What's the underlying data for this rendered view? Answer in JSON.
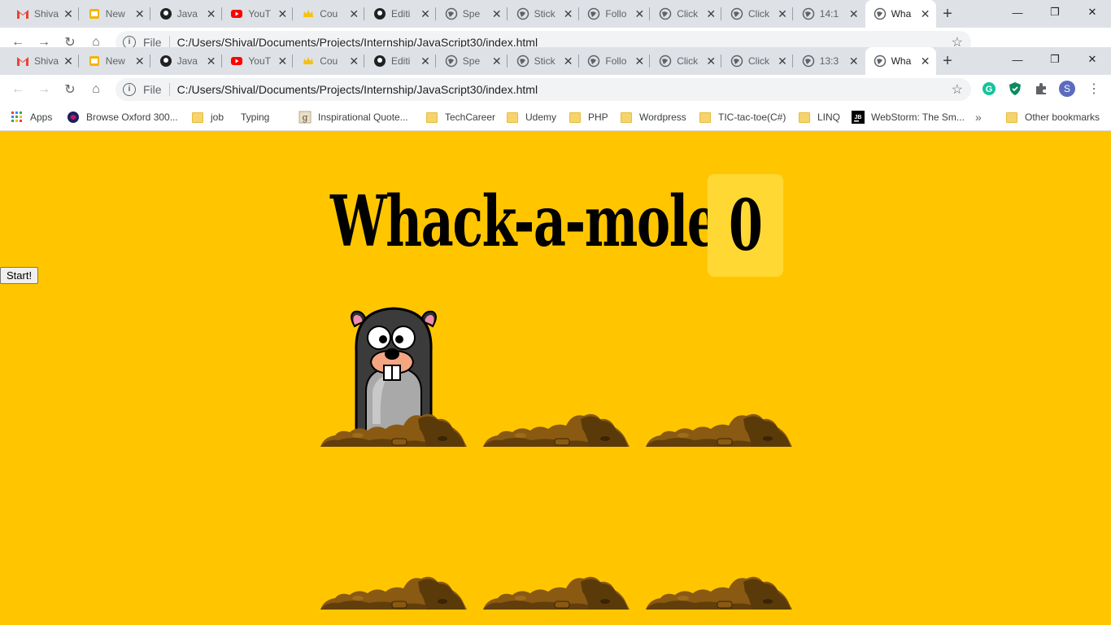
{
  "browser_back": {
    "tabs": [
      {
        "title": "Shiva",
        "icon": "gmail-icon"
      },
      {
        "title": "New",
        "icon": "slides-icon"
      },
      {
        "title": "Java",
        "icon": "github-icon"
      },
      {
        "title": "YouT",
        "icon": "youtube-icon"
      },
      {
        "title": "Cou",
        "icon": "crown-icon"
      },
      {
        "title": "Editi",
        "icon": "github-icon"
      },
      {
        "title": "Spe",
        "icon": "globe-icon"
      },
      {
        "title": "Stick",
        "icon": "globe-icon"
      },
      {
        "title": "Follo",
        "icon": "globe-icon"
      },
      {
        "title": "Click",
        "icon": "globe-icon"
      },
      {
        "title": "Click",
        "icon": "globe-icon"
      },
      {
        "title": "14:1",
        "icon": "globe-icon"
      },
      {
        "title": "Wha",
        "icon": "globe-icon"
      }
    ],
    "url": "C:/Users/Shival/Documents/Projects/Internship/JavaScript30/index.html",
    "file_label": "File"
  },
  "browser": {
    "tabs": [
      {
        "title": "Shiva",
        "icon": "gmail-icon"
      },
      {
        "title": "New",
        "icon": "slides-icon"
      },
      {
        "title": "Java",
        "icon": "github-icon"
      },
      {
        "title": "YouT",
        "icon": "youtube-icon"
      },
      {
        "title": "Cou",
        "icon": "crown-icon"
      },
      {
        "title": "Editi",
        "icon": "github-icon"
      },
      {
        "title": "Spe",
        "icon": "globe-icon"
      },
      {
        "title": "Stick",
        "icon": "globe-icon"
      },
      {
        "title": "Follo",
        "icon": "globe-icon"
      },
      {
        "title": "Click",
        "icon": "globe-icon"
      },
      {
        "title": "Click",
        "icon": "globe-icon"
      },
      {
        "title": "13:3",
        "icon": "globe-icon"
      },
      {
        "title": "Wha",
        "icon": "globe-icon"
      }
    ],
    "active_tab": 12,
    "url": "C:/Users/Shival/Documents/Projects/Internship/JavaScript30/index.html",
    "file_label": "File",
    "profile_initial": "S",
    "bookmarks": [
      {
        "label": "Apps",
        "icon": "apps-grid-icon"
      },
      {
        "label": "Browse Oxford 300...",
        "icon": "oxford-icon"
      },
      {
        "label": "job",
        "icon": "folder-icon"
      },
      {
        "label": "Typing",
        "icon": "none"
      },
      {
        "label": "Inspirational Quote...",
        "icon": "g-icon"
      },
      {
        "label": "TechCareer",
        "icon": "folder-icon"
      },
      {
        "label": "Udemy",
        "icon": "folder-icon"
      },
      {
        "label": "PHP",
        "icon": "folder-icon"
      },
      {
        "label": "Wordpress",
        "icon": "folder-icon"
      },
      {
        "label": "TIC-tac-toe(C#)",
        "icon": "folder-icon"
      },
      {
        "label": "LINQ",
        "icon": "folder-icon"
      },
      {
        "label": "WebStorm: The Sm...",
        "icon": "jb-icon"
      }
    ],
    "overflow_label": "»",
    "other_bookmarks": "Other bookmarks"
  },
  "game": {
    "title": "Whack-a-mole!",
    "score": "0",
    "start_label": "Start!",
    "holes": [
      {
        "has_mole": true
      },
      {
        "has_mole": false
      },
      {
        "has_mole": false
      },
      {
        "has_mole": false
      },
      {
        "has_mole": false
      },
      {
        "has_mole": false
      }
    ]
  },
  "colors": {
    "background": "#ffc600",
    "score_box": "#ffd834",
    "dirt_dark": "#5b3a0a",
    "dirt_light": "#8a5a12"
  }
}
